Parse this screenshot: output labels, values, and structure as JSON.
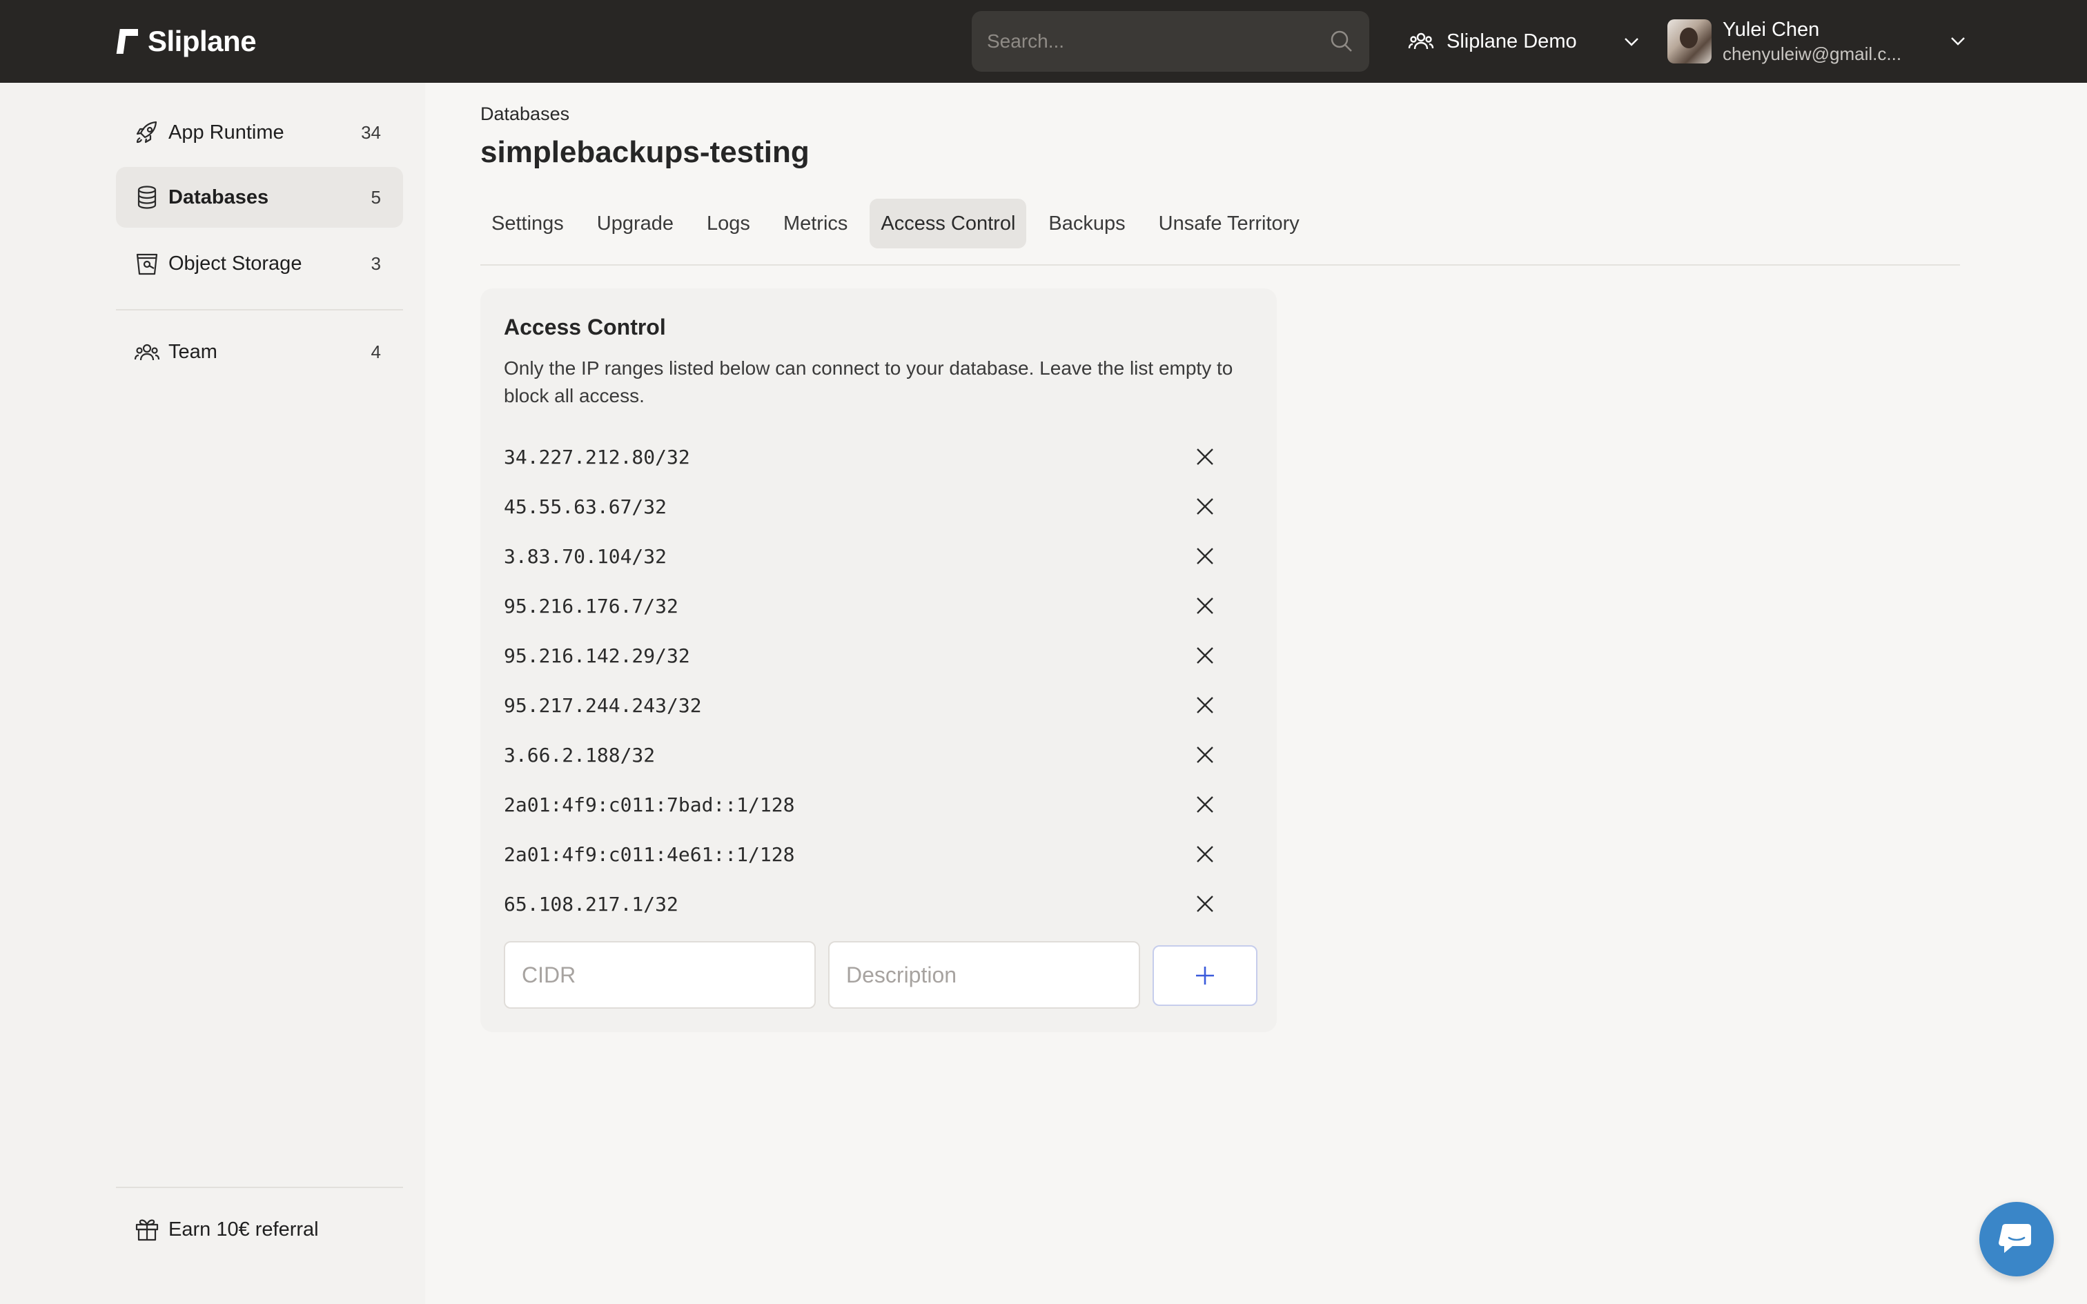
{
  "app": {
    "name": "Sliplane"
  },
  "header": {
    "search_placeholder": "Search...",
    "org_name": "Sliplane Demo",
    "user_name": "Yulei Chen",
    "user_email": "chenyuleiw@gmail.c..."
  },
  "sidebar": {
    "items": [
      {
        "label": "App Runtime",
        "count": "34",
        "icon": "rocket-icon"
      },
      {
        "label": "Databases",
        "count": "5",
        "icon": "database-icon",
        "active": true
      },
      {
        "label": "Object Storage",
        "count": "3",
        "icon": "bucket-icon"
      },
      {
        "label": "Team",
        "count": "4",
        "icon": "team-icon"
      }
    ],
    "referral_label": "Earn 10€ referral"
  },
  "main": {
    "breadcrumb": "Databases",
    "title": "simplebackups-testing",
    "tabs": [
      {
        "label": "Settings"
      },
      {
        "label": "Upgrade"
      },
      {
        "label": "Logs"
      },
      {
        "label": "Metrics"
      },
      {
        "label": "Access Control",
        "active": true
      },
      {
        "label": "Backups"
      },
      {
        "label": "Unsafe Territory"
      }
    ]
  },
  "access_control": {
    "title": "Access Control",
    "description": "Only the IP ranges listed below can connect to your database. Leave the list empty to block all access.",
    "entries": [
      "34.227.212.80/32",
      "45.55.63.67/32",
      "3.83.70.104/32",
      "95.216.176.7/32",
      "95.216.142.29/32",
      "95.217.244.243/32",
      "3.66.2.188/32",
      "2a01:4f9:c011:7bad::1/128",
      "2a01:4f9:c011:4e61::1/128",
      "65.108.217.1/32"
    ],
    "cidr_placeholder": "CIDR",
    "description_placeholder": "Description"
  },
  "colors": {
    "topbar": "#282624",
    "sidebar": "#f3f2f0",
    "accent": "#3b5bdb",
    "chat": "#3a86c8"
  }
}
